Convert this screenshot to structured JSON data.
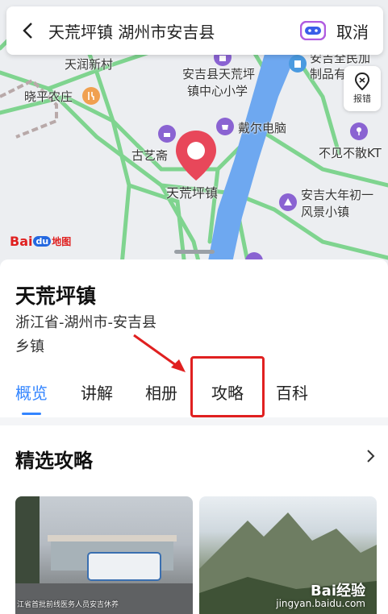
{
  "search": {
    "query": "天荒坪镇 湖州市安吉县",
    "cancel_label": "取消"
  },
  "map": {
    "report_label": "报错",
    "logo_text": "Bai",
    "logo_du": "du",
    "logo_suffix": "地图",
    "labels": {
      "tianrun": "天润新村",
      "xiaoping": "晓平农庄",
      "school1": "安吉县天荒坪",
      "school2": "镇中心小学",
      "anji1": "安吉全民加",
      "anji2": "制品有限公",
      "daier": "戴尔电脑",
      "bujian": "不见不散KT",
      "guyi": "古艺斋",
      "center": "天荒坪镇",
      "newyear1": "安吉大年初一",
      "newyear2": "风景小镇"
    },
    "colors": {
      "road_green": "#7fd48f",
      "river_blue": "#6ea8f0",
      "pin_red": "#e8475a",
      "poi_purple": "#8a63d2"
    }
  },
  "place": {
    "name": "天荒坪镇",
    "address": "浙江省-湖州市-安吉县",
    "type": "乡镇"
  },
  "tabs": [
    {
      "label": "概览",
      "active": true
    },
    {
      "label": "讲解",
      "active": false
    },
    {
      "label": "相册",
      "active": false
    },
    {
      "label": "攻略",
      "active": false
    },
    {
      "label": "百科",
      "active": false
    }
  ],
  "section": {
    "title": "精选攻略"
  },
  "cards": [
    {
      "caption": "江省首批前线医务人员安吉休养"
    },
    {
      "watermark_brand": "Bai经验",
      "watermark_url": "jingyan.baidu.com"
    }
  ],
  "colors": {
    "accent": "#3385ff",
    "highlight": "#e02020"
  }
}
